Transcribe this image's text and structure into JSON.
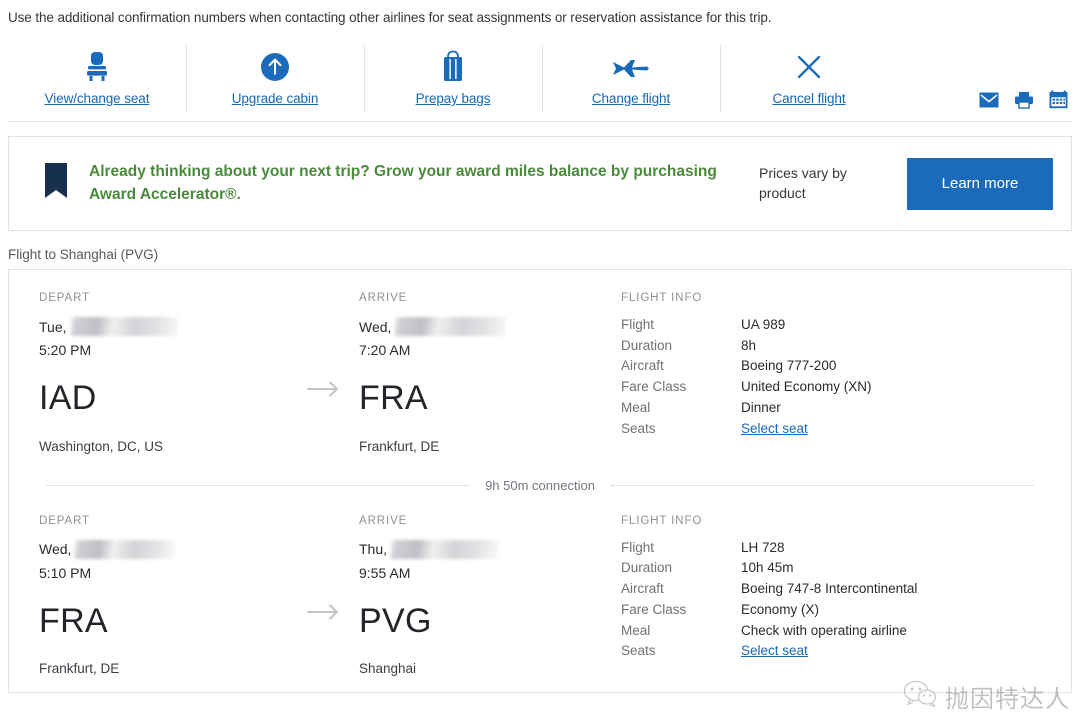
{
  "notice": "Use the additional confirmation numbers when contacting other airlines for seat assignments or reservation assistance for this trip.",
  "toolbar": {
    "actions": [
      {
        "label": "View/change seat",
        "icon": "seat-icon"
      },
      {
        "label": "Upgrade cabin",
        "icon": "arrow-up-circle-icon"
      },
      {
        "label": "Prepay bags",
        "icon": "suitcase-icon"
      },
      {
        "label": "Change flight",
        "icon": "airplane-icon"
      },
      {
        "label": "Cancel flight",
        "icon": "close-x-icon"
      }
    ],
    "utilities": [
      {
        "icon": "email-icon"
      },
      {
        "icon": "print-icon"
      },
      {
        "icon": "calendar-icon"
      }
    ]
  },
  "promo": {
    "icon": "bookmark-icon",
    "headline": "Already thinking about your next trip? Grow your award miles balance by purchasing Award Accelerator®.",
    "price_note": "Prices vary by product",
    "cta_label": "Learn more",
    "text_color": "#4a8a3c",
    "cta_color": "#1c6bba",
    "icon_color": "#16304d"
  },
  "flight_section": {
    "title": "Flight to Shanghai (PVG)",
    "connection_label": "9h 50m connection",
    "column_headers": {
      "depart": "DEPART",
      "arrive": "ARRIVE",
      "info": "FLIGHT INFO"
    },
    "segments": [
      {
        "depart": {
          "day": "Tue,",
          "date_redacted": true,
          "time": "5:20 PM",
          "airport": "IAD",
          "city": "Washington, DC, US"
        },
        "arrive": {
          "day": "Wed,",
          "date_redacted": true,
          "time": "7:20 AM",
          "airport": "FRA",
          "city": "Frankfurt, DE"
        },
        "info": [
          {
            "label": "Flight",
            "value": "UA 989",
            "link": false
          },
          {
            "label": "Duration",
            "value": "8h",
            "link": false
          },
          {
            "label": "Aircraft",
            "value": "Boeing 777-200",
            "link": false
          },
          {
            "label": "Fare Class",
            "value": "United Economy (XN)",
            "link": false
          },
          {
            "label": "Meal",
            "value": "Dinner",
            "link": false
          },
          {
            "label": "Seats",
            "value": "Select seat",
            "link": true
          }
        ]
      },
      {
        "depart": {
          "day": "Wed,",
          "date_redacted": true,
          "time": "5:10 PM",
          "airport": "FRA",
          "city": "Frankfurt, DE"
        },
        "arrive": {
          "day": "Thu,",
          "date_redacted": true,
          "time": "9:55 AM",
          "airport": "PVG",
          "city": "Shanghai"
        },
        "info": [
          {
            "label": "Flight",
            "value": "LH 728",
            "link": false
          },
          {
            "label": "Duration",
            "value": "10h 45m",
            "link": false
          },
          {
            "label": "Aircraft",
            "value": "Boeing 747-8 Intercontinental",
            "link": false
          },
          {
            "label": "Fare Class",
            "value": "Economy (X)",
            "link": false
          },
          {
            "label": "Meal",
            "value": "Check with operating airline",
            "link": false
          },
          {
            "label": "Seats",
            "value": "Select seat",
            "link": true
          }
        ]
      }
    ]
  },
  "watermark": {
    "icon": "wechat-icon",
    "text": "抛因特达人"
  },
  "colors": {
    "link": "#1668b5",
    "accent_blue": "#1c6bba",
    "promo_green": "#4a8a3c"
  }
}
